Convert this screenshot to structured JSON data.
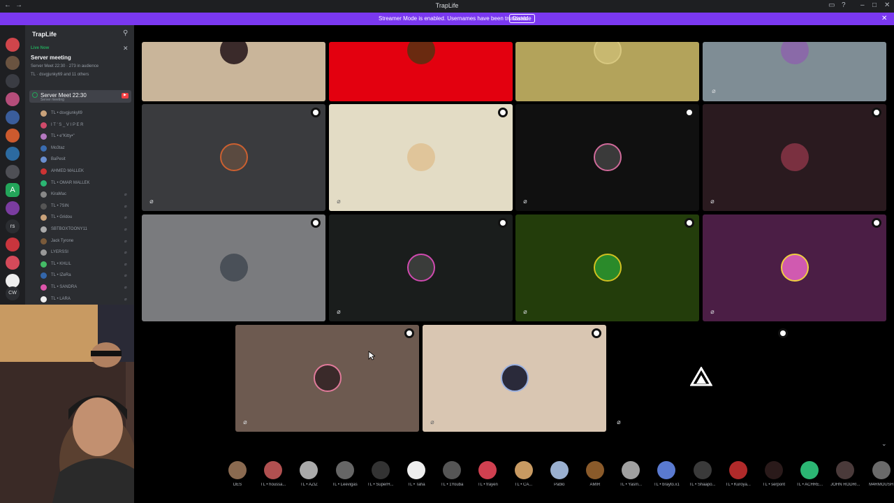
{
  "window": {
    "title": "TrapLife"
  },
  "banner": {
    "message": "Streamer Mode is enabled. Usernames have been truncated.",
    "button": "Disable"
  },
  "sidebar": {
    "server_name": "TrapLife",
    "live_label": "Live Now",
    "event_title": "Server meeting",
    "event_meta": "Server Meet 22:30 · 273 in audience",
    "event_people": "TL · dsvgjunky69 and 11 others",
    "voice_channel": {
      "name": "Server Meet 22:30",
      "subtitle": "Server meeting"
    },
    "members": [
      {
        "name": "TL • dsvgjunkyll9",
        "color": "#c9a27a"
      },
      {
        "name": "I T ' S _ V I P E R",
        "color": "#d04a6a"
      },
      {
        "name": "TL • e\"Kitty•\"",
        "color": "#b478c0"
      },
      {
        "name": "Mo3taz",
        "color": "#3a6cb0"
      },
      {
        "name": "BaPesit",
        "color": "#6a8fd0"
      },
      {
        "name": "AHMED MALLEK",
        "color": "#c33"
      },
      {
        "name": "TL • OMAR MALLEK",
        "color": "#2bb673"
      },
      {
        "name": "KiraMac",
        "color": "#888"
      },
      {
        "name": "TL • 7SIN",
        "color": "#555"
      },
      {
        "name": "TL • Gridou",
        "color": "#c9a27a"
      },
      {
        "name": "SBTBOXTOONY11",
        "color": "#aaa"
      },
      {
        "name": "Jack Tyrone",
        "color": "#7a5a3a"
      },
      {
        "name": "LYERSSI",
        "color": "#999"
      },
      {
        "name": "TL • KHLIL",
        "color": "#4b6"
      },
      {
        "name": "TL • IZeRa",
        "color": "#36a"
      },
      {
        "name": "TL • SANDRA",
        "color": "#d5a"
      },
      {
        "name": "TL • LARA",
        "color": "#eee"
      }
    ]
  },
  "strip": {
    "names": [
      "DES",
      "TL • houssa...",
      "TL • AZIZ",
      "TL • Leevigas",
      "TL • SuperH...",
      "TL • Taha",
      "TL • 1Youba",
      "TL • frayen",
      "TL • CA...",
      "Pablo",
      "AMIR",
      "TL • Yasm...",
      "TL • brayto.x1",
      "TL • Shaapo...",
      "TL • Kuroya...",
      "TL • serpont",
      "TL • ACHRE...",
      "JOHN RODRI...",
      "M4RMOUSH"
    ]
  },
  "colors": {
    "accent": "#7a38f0",
    "live": "#23a55a",
    "danger": "#f23f43"
  }
}
